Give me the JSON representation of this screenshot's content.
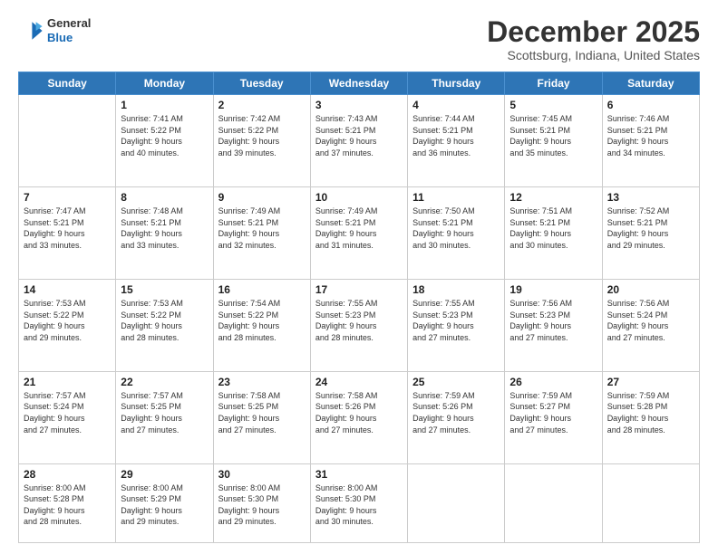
{
  "logo": {
    "line1": "General",
    "line2": "Blue"
  },
  "header": {
    "title": "December 2025",
    "subtitle": "Scottsburg, Indiana, United States"
  },
  "days_of_week": [
    "Sunday",
    "Monday",
    "Tuesday",
    "Wednesday",
    "Thursday",
    "Friday",
    "Saturday"
  ],
  "weeks": [
    [
      {
        "day": "",
        "info": ""
      },
      {
        "day": "1",
        "info": "Sunrise: 7:41 AM\nSunset: 5:22 PM\nDaylight: 9 hours\nand 40 minutes."
      },
      {
        "day": "2",
        "info": "Sunrise: 7:42 AM\nSunset: 5:22 PM\nDaylight: 9 hours\nand 39 minutes."
      },
      {
        "day": "3",
        "info": "Sunrise: 7:43 AM\nSunset: 5:21 PM\nDaylight: 9 hours\nand 37 minutes."
      },
      {
        "day": "4",
        "info": "Sunrise: 7:44 AM\nSunset: 5:21 PM\nDaylight: 9 hours\nand 36 minutes."
      },
      {
        "day": "5",
        "info": "Sunrise: 7:45 AM\nSunset: 5:21 PM\nDaylight: 9 hours\nand 35 minutes."
      },
      {
        "day": "6",
        "info": "Sunrise: 7:46 AM\nSunset: 5:21 PM\nDaylight: 9 hours\nand 34 minutes."
      }
    ],
    [
      {
        "day": "7",
        "info": "Sunrise: 7:47 AM\nSunset: 5:21 PM\nDaylight: 9 hours\nand 33 minutes."
      },
      {
        "day": "8",
        "info": "Sunrise: 7:48 AM\nSunset: 5:21 PM\nDaylight: 9 hours\nand 33 minutes."
      },
      {
        "day": "9",
        "info": "Sunrise: 7:49 AM\nSunset: 5:21 PM\nDaylight: 9 hours\nand 32 minutes."
      },
      {
        "day": "10",
        "info": "Sunrise: 7:49 AM\nSunset: 5:21 PM\nDaylight: 9 hours\nand 31 minutes."
      },
      {
        "day": "11",
        "info": "Sunrise: 7:50 AM\nSunset: 5:21 PM\nDaylight: 9 hours\nand 30 minutes."
      },
      {
        "day": "12",
        "info": "Sunrise: 7:51 AM\nSunset: 5:21 PM\nDaylight: 9 hours\nand 30 minutes."
      },
      {
        "day": "13",
        "info": "Sunrise: 7:52 AM\nSunset: 5:21 PM\nDaylight: 9 hours\nand 29 minutes."
      }
    ],
    [
      {
        "day": "14",
        "info": "Sunrise: 7:53 AM\nSunset: 5:22 PM\nDaylight: 9 hours\nand 29 minutes."
      },
      {
        "day": "15",
        "info": "Sunrise: 7:53 AM\nSunset: 5:22 PM\nDaylight: 9 hours\nand 28 minutes."
      },
      {
        "day": "16",
        "info": "Sunrise: 7:54 AM\nSunset: 5:22 PM\nDaylight: 9 hours\nand 28 minutes."
      },
      {
        "day": "17",
        "info": "Sunrise: 7:55 AM\nSunset: 5:23 PM\nDaylight: 9 hours\nand 28 minutes."
      },
      {
        "day": "18",
        "info": "Sunrise: 7:55 AM\nSunset: 5:23 PM\nDaylight: 9 hours\nand 27 minutes."
      },
      {
        "day": "19",
        "info": "Sunrise: 7:56 AM\nSunset: 5:23 PM\nDaylight: 9 hours\nand 27 minutes."
      },
      {
        "day": "20",
        "info": "Sunrise: 7:56 AM\nSunset: 5:24 PM\nDaylight: 9 hours\nand 27 minutes."
      }
    ],
    [
      {
        "day": "21",
        "info": "Sunrise: 7:57 AM\nSunset: 5:24 PM\nDaylight: 9 hours\nand 27 minutes."
      },
      {
        "day": "22",
        "info": "Sunrise: 7:57 AM\nSunset: 5:25 PM\nDaylight: 9 hours\nand 27 minutes."
      },
      {
        "day": "23",
        "info": "Sunrise: 7:58 AM\nSunset: 5:25 PM\nDaylight: 9 hours\nand 27 minutes."
      },
      {
        "day": "24",
        "info": "Sunrise: 7:58 AM\nSunset: 5:26 PM\nDaylight: 9 hours\nand 27 minutes."
      },
      {
        "day": "25",
        "info": "Sunrise: 7:59 AM\nSunset: 5:26 PM\nDaylight: 9 hours\nand 27 minutes."
      },
      {
        "day": "26",
        "info": "Sunrise: 7:59 AM\nSunset: 5:27 PM\nDaylight: 9 hours\nand 27 minutes."
      },
      {
        "day": "27",
        "info": "Sunrise: 7:59 AM\nSunset: 5:28 PM\nDaylight: 9 hours\nand 28 minutes."
      }
    ],
    [
      {
        "day": "28",
        "info": "Sunrise: 8:00 AM\nSunset: 5:28 PM\nDaylight: 9 hours\nand 28 minutes."
      },
      {
        "day": "29",
        "info": "Sunrise: 8:00 AM\nSunset: 5:29 PM\nDaylight: 9 hours\nand 29 minutes."
      },
      {
        "day": "30",
        "info": "Sunrise: 8:00 AM\nSunset: 5:30 PM\nDaylight: 9 hours\nand 29 minutes."
      },
      {
        "day": "31",
        "info": "Sunrise: 8:00 AM\nSunset: 5:30 PM\nDaylight: 9 hours\nand 30 minutes."
      },
      {
        "day": "",
        "info": ""
      },
      {
        "day": "",
        "info": ""
      },
      {
        "day": "",
        "info": ""
      }
    ]
  ]
}
